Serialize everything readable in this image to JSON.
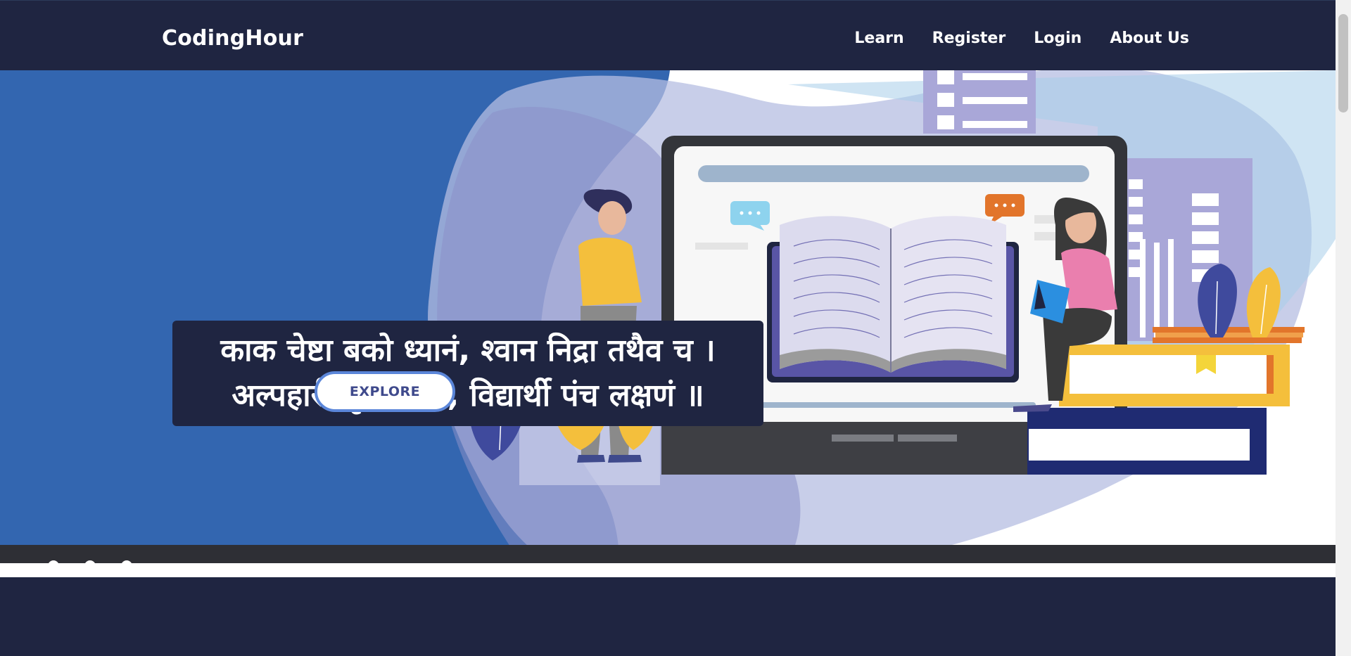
{
  "navbar": {
    "brand": "CodingHour",
    "links": [
      "Learn",
      "Register",
      "Login",
      "About Us"
    ]
  },
  "hero": {
    "quote_line_1": "काक चेष्टा बको ध्यानं, श्वान निद्रा तथैव च ।",
    "quote_line_2": "अल्पहारी गृह त्यागी, विद्यार्थी पंच लक्षणं ॥",
    "explore_label": "EXPLORE"
  },
  "carousel": {
    "active_slide": 1,
    "slide_count": 3
  },
  "colors": {
    "navbar_bg": "#1f2541",
    "hero_blue": "#3366b0",
    "button_border": "#5b86d9",
    "button_text": "#3f4a8c"
  },
  "icons": [
    "speech-bubble-icon",
    "open-book-icon",
    "laptop-icon"
  ]
}
